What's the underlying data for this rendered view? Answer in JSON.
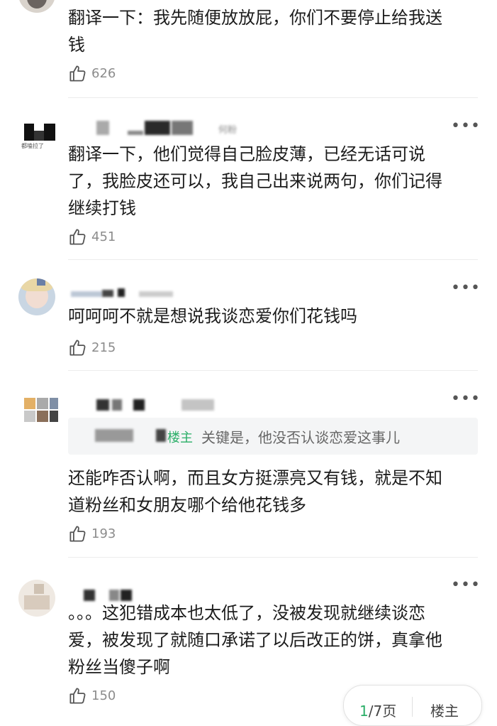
{
  "comments": [
    {
      "text": "翻译一下：我先随便放放屁，你们不要停止给我送\n钱",
      "likes": "626"
    },
    {
      "avatar_caption": "都嗑拉了",
      "author_tail": "何粉",
      "text": "翻译一下，他们觉得自己脸皮薄，已经无话可说\n了，我脸皮还可以，我自己出来说两句，你们记得\n继续打钱",
      "likes": "451"
    },
    {
      "text": "呵呵呵不就是想说我谈恋爱你们花钱吗",
      "likes": "215"
    },
    {
      "quote_tag": "楼主",
      "quote_text": "关键是，他没否认谈恋爱这事儿",
      "text": "还能咋否认啊，而且女方挺漂亮又有钱，就是不知\n道粉丝和女朋友哪个给他花钱多",
      "likes": "193"
    },
    {
      "text": "。。。这犯错成本也太低了，没被发现就继续谈恋\n爱，被发现了就随口承诺了以后改正的饼，真拿他\n粉丝当傻子啊",
      "likes": "150"
    }
  ],
  "more_label": "•••",
  "pager": {
    "current": "1",
    "total_label": "/7页",
    "owner_label": "楼主"
  },
  "colors": {
    "accent": "#2aae67",
    "like_gray": "#8c8c8c",
    "quote_bg": "#f4f5f6"
  },
  "icons": {
    "like": "thumbs-up-icon",
    "more": "more-dots-icon"
  }
}
